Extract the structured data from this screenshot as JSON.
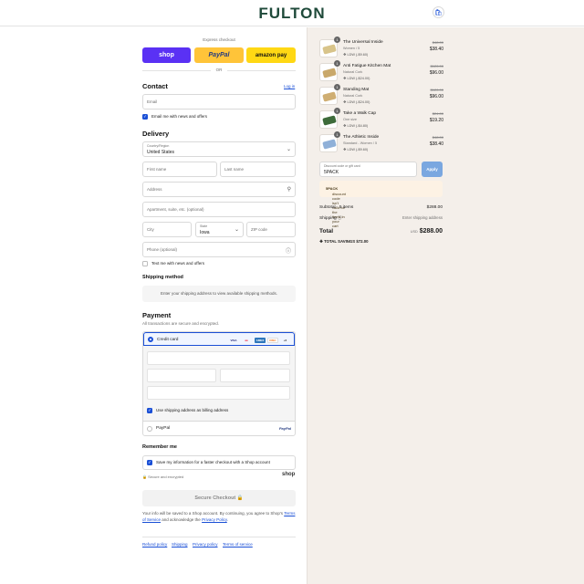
{
  "header": {
    "logo": "FULTON",
    "cart_icon": "bag-icon"
  },
  "express": {
    "label": "Express checkout",
    "shop": "shop",
    "paypal": "PayPal",
    "amazon": "amazon pay",
    "or": "OR"
  },
  "contact": {
    "title": "Contact",
    "login": "Log in",
    "email_placeholder": "Email",
    "news_label": "Email me with news and offers",
    "news_checked": true
  },
  "delivery": {
    "title": "Delivery",
    "country_label": "Country/Region",
    "country_value": "United States",
    "first_name": "First name",
    "last_name": "Last name",
    "address": "Address",
    "apartment": "Apartment, suite, etc. (optional)",
    "city": "City",
    "state_label": "State",
    "state_value": "Iowa",
    "zip": "ZIP code",
    "phone": "Phone (optional)",
    "text_label": "Text me with news and offers",
    "text_checked": false
  },
  "shipping": {
    "title": "Shipping method",
    "message": "Enter your shipping address to view available shipping methods."
  },
  "payment": {
    "title": "Payment",
    "subtitle": "All transactions are secure and encrypted.",
    "credit_card": "Credit card",
    "cards": [
      "VISA",
      "MC",
      "AMEX",
      "DISC",
      "+6"
    ],
    "billing_label": "Use shipping address as billing address",
    "billing_checked": true,
    "paypal": "PayPal",
    "paypal_logo": "PayPal"
  },
  "remember": {
    "title": "Remember me",
    "save_label": "Save my information for a faster checkout with a Shop account",
    "secure": "Secure and encrypted",
    "shop": "shop"
  },
  "checkout": {
    "button": "Secure Checkout",
    "legal_1": "Your info will be saved to a Shop account. By continuing, you agree to Shop's",
    "terms": "Terms of Service",
    "legal_2": "and acknowledge the",
    "privacy": "Privacy Policy",
    "legal_end": "."
  },
  "footer": {
    "links": [
      "Refund policy",
      "Shipping",
      "Privacy policy",
      "Terms of service"
    ]
  },
  "cart": {
    "items": [
      {
        "name": "The Universal Inside",
        "variant": "Women / 5",
        "deal": "LDW (-$9.60)",
        "old_price": "$48.00",
        "price": "$38.40",
        "qty": "1",
        "thumb_color": "#d8c48a"
      },
      {
        "name": "Anti Fatigue Kitchen Mat",
        "variant": "Natural Cork",
        "deal": "LDW (-$24.00)",
        "old_price": "$120.00",
        "price": "$96.00",
        "qty": "1",
        "thumb_color": "#c9a86a"
      },
      {
        "name": "Standing Mat",
        "variant": "Natural Cork",
        "deal": "LDW (-$24.00)",
        "old_price": "$120.00",
        "price": "$96.00",
        "qty": "1",
        "thumb_color": "#cfae72"
      },
      {
        "name": "Take a Walk Cap",
        "variant": "One size",
        "deal": "LDW (-$4.80)",
        "old_price": "$24.00",
        "price": "$19.20",
        "qty": "1",
        "thumb_color": "#3d6b3a"
      },
      {
        "name": "The Athletic Inside",
        "variant": "Standard - Women / 5",
        "deal": "LDW (-$9.60)",
        "old_price": "$48.00",
        "price": "$38.40",
        "qty": "1",
        "thumb_color": "#8fb0d8"
      }
    ],
    "discount_label": "Discount code or gift card",
    "discount_value": "5PACK",
    "apply": "Apply",
    "error_code": "5PACK",
    "error_text": "discount code isn't valid for the items in your cart",
    "subtotal_label": "Subtotal · 5 items",
    "subtotal": "$288.00",
    "shipping_label": "Shipping",
    "shipping_value": "Enter shipping address",
    "total_label": "Total",
    "currency": "USD",
    "total": "$288.00",
    "savings_label": "TOTAL SAVINGS",
    "savings": "$72.00"
  }
}
